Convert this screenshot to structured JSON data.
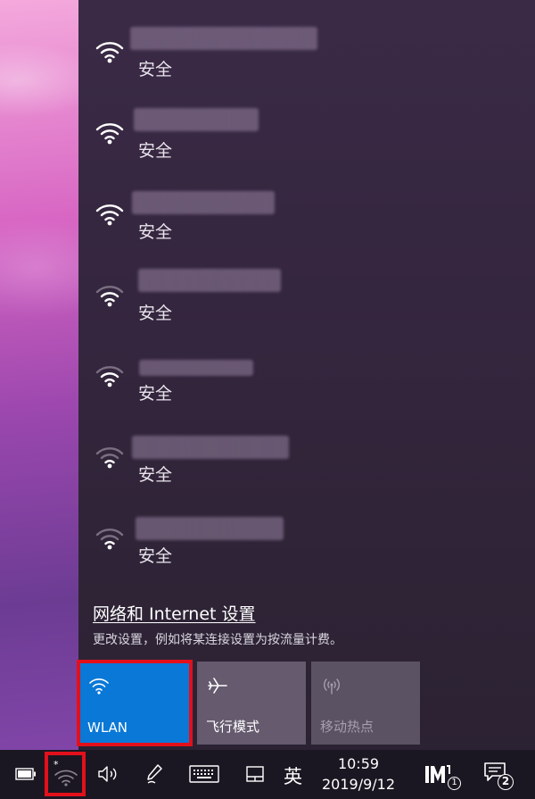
{
  "networks": [
    {
      "status": "安全",
      "signal": 4
    },
    {
      "status": "安全",
      "signal": 4
    },
    {
      "status": "安全",
      "signal": 4
    },
    {
      "status": "安全",
      "signal": 2
    },
    {
      "status": "安全",
      "signal": 2
    },
    {
      "status": "安全",
      "signal": 1
    },
    {
      "status": "安全",
      "signal": 1
    }
  ],
  "settings": {
    "link": "网络和 Internet 设置",
    "description": "更改设置，例如将某连接设置为按流量计费。"
  },
  "tiles": {
    "wlan": {
      "label": "WLAN",
      "icon": "wifi-icon",
      "state": "on",
      "color": "#0a78d7"
    },
    "airplane": {
      "label": "飞行模式",
      "icon": "airplane-icon",
      "state": "off"
    },
    "hotspot": {
      "label": "移动热点",
      "icon": "hotspot-icon",
      "state": "disabled"
    }
  },
  "taskbar": {
    "language": "英",
    "time": "10:59",
    "date": "2019/9/12",
    "app_badge": "1",
    "notification_count": "2",
    "icons": [
      "battery-icon",
      "wifi-icon",
      "volume-icon",
      "pen-icon",
      "keyboard-icon",
      "touchpad-icon",
      "app-icon",
      "action-center-icon"
    ]
  },
  "highlight_color": "#e3101b"
}
